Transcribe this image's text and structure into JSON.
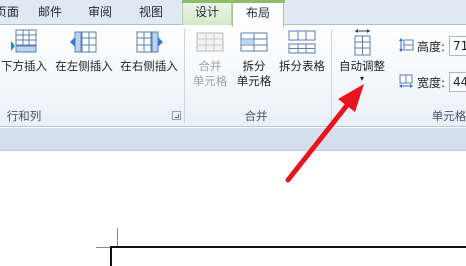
{
  "tabs": [
    {
      "label": "页面"
    },
    {
      "label": "邮件"
    },
    {
      "label": "审阅"
    },
    {
      "label": "视图"
    },
    {
      "label": "设计"
    },
    {
      "label": "布局"
    }
  ],
  "groups": {
    "rows_columns": {
      "label": "行和列",
      "insert_below": "下方插入",
      "insert_left": "在左侧插入",
      "insert_right": "在右侧插入"
    },
    "merge": {
      "label": "合并",
      "merge_cells": [
        "合并",
        "单元格"
      ],
      "split_cells": [
        "拆分",
        "单元格"
      ],
      "split_table": "拆分表格"
    },
    "cell_size": {
      "label": "单元格",
      "autofit": "自动调整",
      "height_label": "高度:",
      "height_value": "71",
      "width_label": "宽度:",
      "width_value": "44"
    }
  },
  "colors": {
    "arrow": "#e8141b",
    "context_tab": "#8cbd6c"
  }
}
